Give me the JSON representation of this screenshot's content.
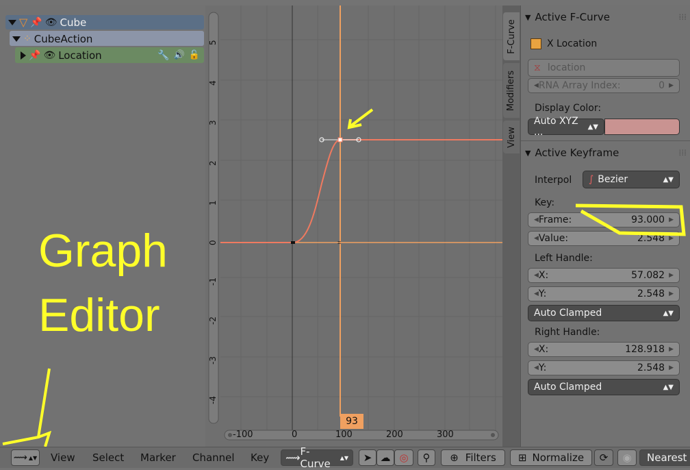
{
  "channels": {
    "rows": [
      {
        "label": "Cube"
      },
      {
        "label": "CubeAction"
      },
      {
        "label": "Location"
      }
    ]
  },
  "graph": {
    "y_ticks": [
      "5",
      "4",
      "3",
      "2",
      "1",
      "0",
      "-1",
      "-2",
      "-3",
      "-4"
    ],
    "x_ticks": [
      "-100",
      "0",
      "100",
      "200",
      "300"
    ],
    "current_frame": "93"
  },
  "tabs": [
    "F-Curve",
    "Modifiers",
    "View"
  ],
  "props": {
    "active_fcurve_title": "Active F-Curve",
    "object_name": "X Location",
    "data_path": "location",
    "rna_index_label": "RNA Array Index:",
    "rna_index_value": "0",
    "display_color_label": "Display Color:",
    "display_color_mode": "Auto XYZ ...",
    "display_color_swatch": "#c99391",
    "active_keyframe_title": "Active Keyframe",
    "interpol_label": "Interpol",
    "interpol_value": "Bezier",
    "key_label": "Key:",
    "frame_label": "Frame:",
    "frame_value": "93.000",
    "value_label": "Value:",
    "value_value": "2.548",
    "left_handle_label": "Left Handle:",
    "lx_label": "X:",
    "lx_value": "57.082",
    "ly_label": "Y:",
    "ly_value": "2.548",
    "left_handle_type": "Auto Clamped",
    "right_handle_label": "Right Handle:",
    "rx_label": "X:",
    "rx_value": "128.918",
    "ry_label": "Y:",
    "ry_value": "2.548",
    "right_handle_type": "Auto Clamped"
  },
  "header": {
    "menus": [
      "View",
      "Select",
      "Marker",
      "Channel",
      "Key"
    ],
    "mode": "F-Curve",
    "filters": "Filters",
    "normalize": "Normalize",
    "snap": "Nearest"
  },
  "annotation": {
    "line1": "Graph",
    "line2": "Editor"
  },
  "colors": {
    "curve": "#f07a60",
    "frame_line": "#f0a060",
    "highlight": "#ffff2a"
  }
}
